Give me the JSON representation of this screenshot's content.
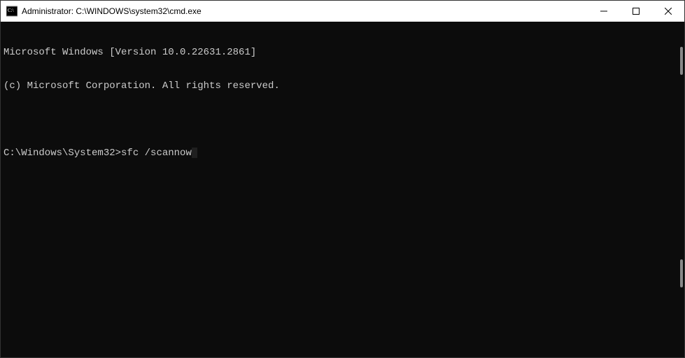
{
  "window": {
    "title": "Administrator: C:\\WINDOWS\\system32\\cmd.exe"
  },
  "terminal": {
    "line1": "Microsoft Windows [Version 10.0.22631.2861]",
    "line2": "(c) Microsoft Corporation. All rights reserved.",
    "blank": "",
    "prompt": "C:\\Windows\\System32>",
    "command": "sfc /scannow"
  }
}
